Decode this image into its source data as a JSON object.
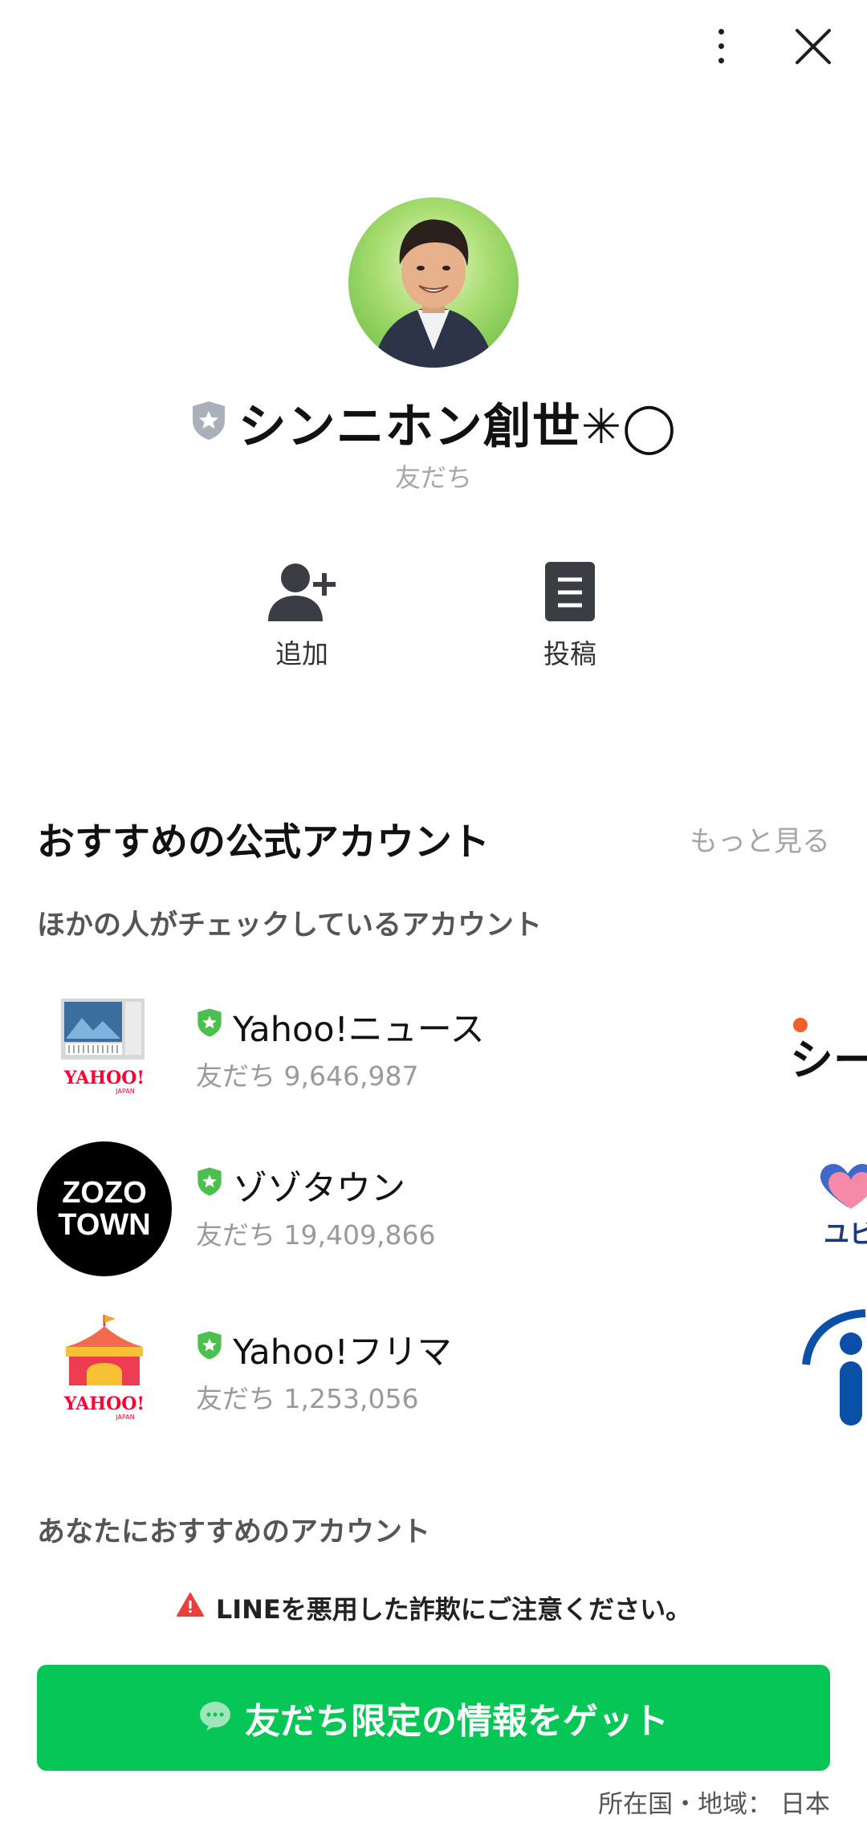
{
  "profile": {
    "name": "シンニホン創世✳︎◯",
    "status": "友だち"
  },
  "actions": {
    "add_label": "追加",
    "post_label": "投稿"
  },
  "recommend": {
    "title": "おすすめの公式アカウント",
    "see_more": "もっと見る",
    "subheading": "ほかの人がチェックしているアカウント",
    "accounts": [
      {
        "name": "Yahoo!ニュース",
        "followers": "友だち 9,646,987"
      },
      {
        "name": "ゾゾタウン",
        "followers": "友だち 19,409,866"
      },
      {
        "name": "Yahoo!フリマ",
        "followers": "友だち 1,253,056"
      }
    ],
    "zozo_logo_line1": "ZOZO",
    "zozo_logo_line2": "TOWN",
    "yahoo_logo": "YAHOO!",
    "yahoo_logo_sub": "JAPAN",
    "side_partial_1": "シーモ",
    "side_partial_2": "ユビ",
    "subheading2": "あなたにおすすめのアカウント"
  },
  "warning": "LINEを悪用した詐欺にご注意ください。",
  "cta_label": "友だち限定の情報をゲット",
  "region": "所在国・地域： 日本",
  "colors": {
    "line_green": "#06c755",
    "badge_green": "#4cc04e",
    "badge_gray": "#a9b0b9",
    "warning_red": "#e8413d"
  }
}
